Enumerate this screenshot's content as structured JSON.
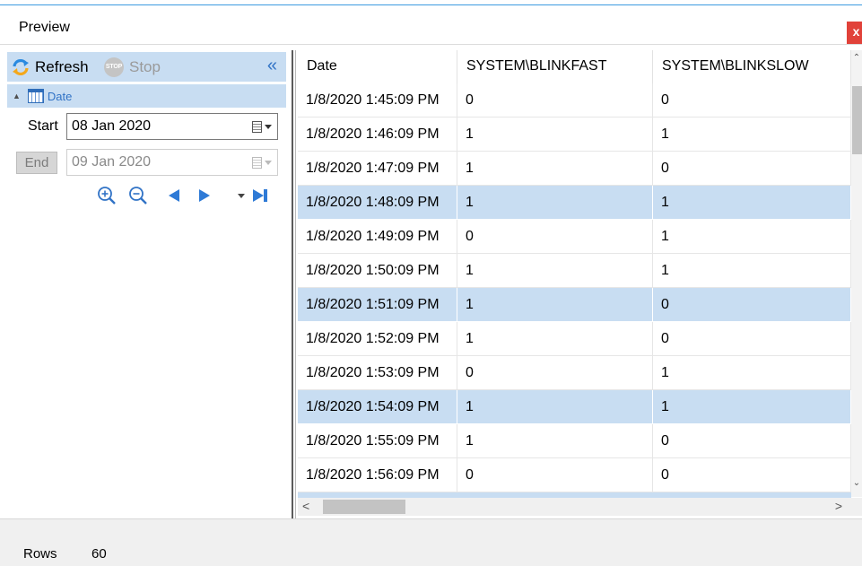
{
  "window": {
    "title": "Preview",
    "close_label": "x"
  },
  "toolbar": {
    "refresh_label": "Refresh",
    "stop_label": "Stop",
    "stop_icon_text": "STOP",
    "collapse_glyph": "«"
  },
  "filter": {
    "group_label": "Date",
    "start_label": "Start",
    "start_value": "08 Jan 2020",
    "end_label": "End",
    "end_value": "09 Jan 2020"
  },
  "grid": {
    "columns": [
      "Date",
      "SYSTEM\\BLINKFAST",
      "SYSTEM\\BLINKSLOW"
    ],
    "rows": [
      {
        "date": "1/8/2020 1:45:09 PM",
        "fast": "0",
        "slow": "0",
        "selected": false
      },
      {
        "date": "1/8/2020 1:46:09 PM",
        "fast": "1",
        "slow": "1",
        "selected": false
      },
      {
        "date": "1/8/2020 1:47:09 PM",
        "fast": "1",
        "slow": "0",
        "selected": false
      },
      {
        "date": "1/8/2020 1:48:09 PM",
        "fast": "1",
        "slow": "1",
        "selected": true
      },
      {
        "date": "1/8/2020 1:49:09 PM",
        "fast": "0",
        "slow": "1",
        "selected": false
      },
      {
        "date": "1/8/2020 1:50:09 PM",
        "fast": "1",
        "slow": "1",
        "selected": false
      },
      {
        "date": "1/8/2020 1:51:09 PM",
        "fast": "1",
        "slow": "0",
        "selected": true
      },
      {
        "date": "1/8/2020 1:52:09 PM",
        "fast": "1",
        "slow": "0",
        "selected": false
      },
      {
        "date": "1/8/2020 1:53:09 PM",
        "fast": "0",
        "slow": "1",
        "selected": false
      },
      {
        "date": "1/8/2020 1:54:09 PM",
        "fast": "1",
        "slow": "1",
        "selected": true
      },
      {
        "date": "1/8/2020 1:55:09 PM",
        "fast": "1",
        "slow": "0",
        "selected": false
      },
      {
        "date": "1/8/2020 1:56:09 PM",
        "fast": "0",
        "slow": "0",
        "selected": false
      }
    ]
  },
  "status": {
    "rows_label": "Rows",
    "rows_value": "60"
  },
  "colors": {
    "accent": "#3173c6",
    "selection": "#c8ddf2",
    "close": "#e1423a"
  }
}
